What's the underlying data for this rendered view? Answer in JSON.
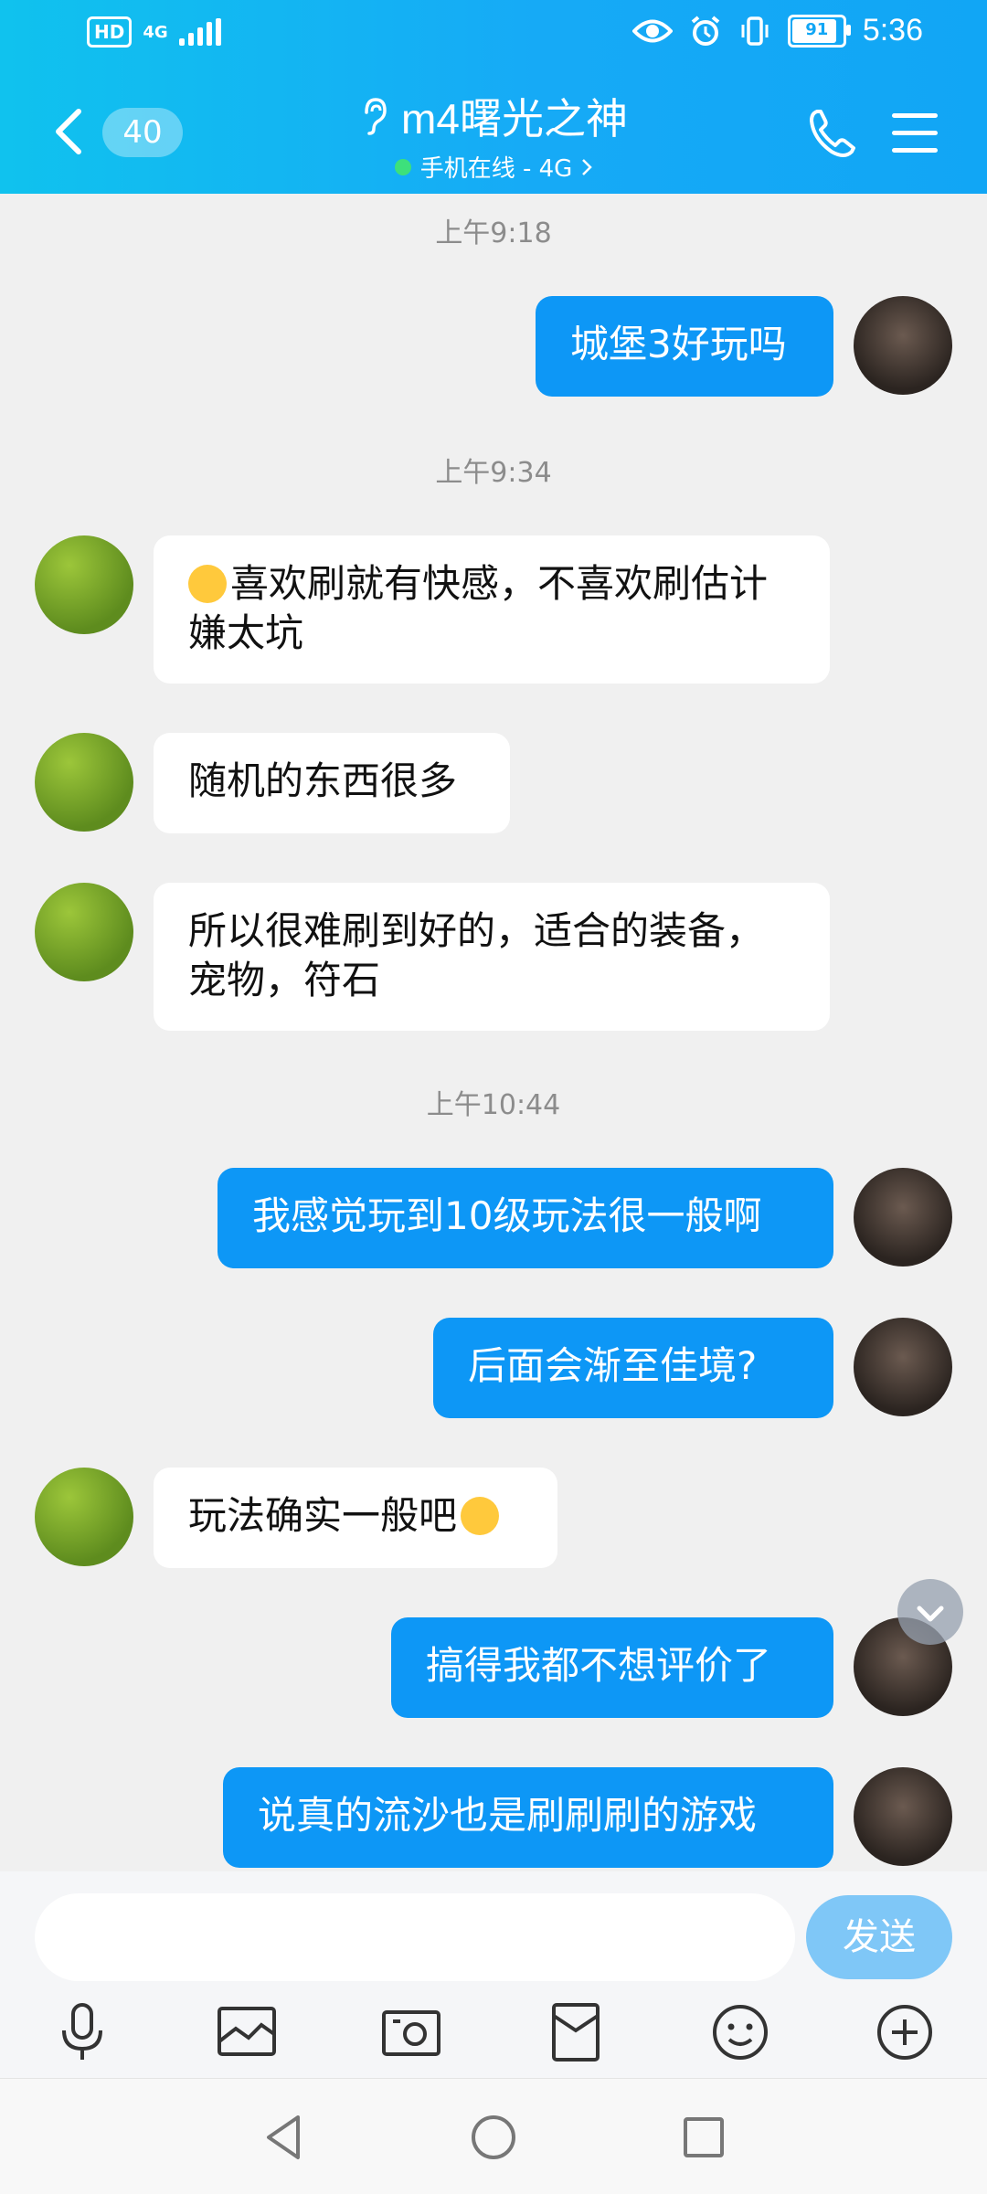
{
  "status_bar": {
    "hd_label": "HD",
    "network": "4G",
    "battery": "91",
    "time": "5:36"
  },
  "header": {
    "unread_count": "40",
    "contact_name": "m4曙光之神",
    "contact_status": "手机在线 - 4G",
    "colors": {
      "bar": "#11a6f5",
      "online_dot": "#3de07b"
    }
  },
  "timestamps": [
    "上午9:18",
    "上午9:34",
    "上午10:44"
  ],
  "messages": [
    {
      "side": "out",
      "text": "城堡3好玩吗"
    },
    {
      "side": "in",
      "text": "喜欢刷就有快感，不喜欢刷估计嫌太坑",
      "emoji": "thinking-face"
    },
    {
      "side": "in",
      "text": "随机的东西很多"
    },
    {
      "side": "in",
      "text": "所以很难刷到好的，适合的装备，宠物，符石"
    },
    {
      "side": "out",
      "text": "我感觉玩到10级玩法很一般啊"
    },
    {
      "side": "out",
      "text": "后面会渐至佳境?"
    },
    {
      "side": "in",
      "text": "玩法确实一般吧",
      "emoji": "kissing-face"
    },
    {
      "side": "out",
      "text": "搞得我都不想评价了"
    },
    {
      "side": "out",
      "text": "说真的流沙也是刷刷刷的游戏"
    }
  ],
  "composer": {
    "send_label": "发送",
    "tools": [
      "microphone-icon",
      "image-icon",
      "camera-icon",
      "red-packet-icon",
      "emoji-icon",
      "plus-icon"
    ]
  },
  "colors": {
    "outgoing_bubble": "#0d97f6",
    "incoming_bubble": "#ffffff",
    "background": "#f0f0f0"
  }
}
